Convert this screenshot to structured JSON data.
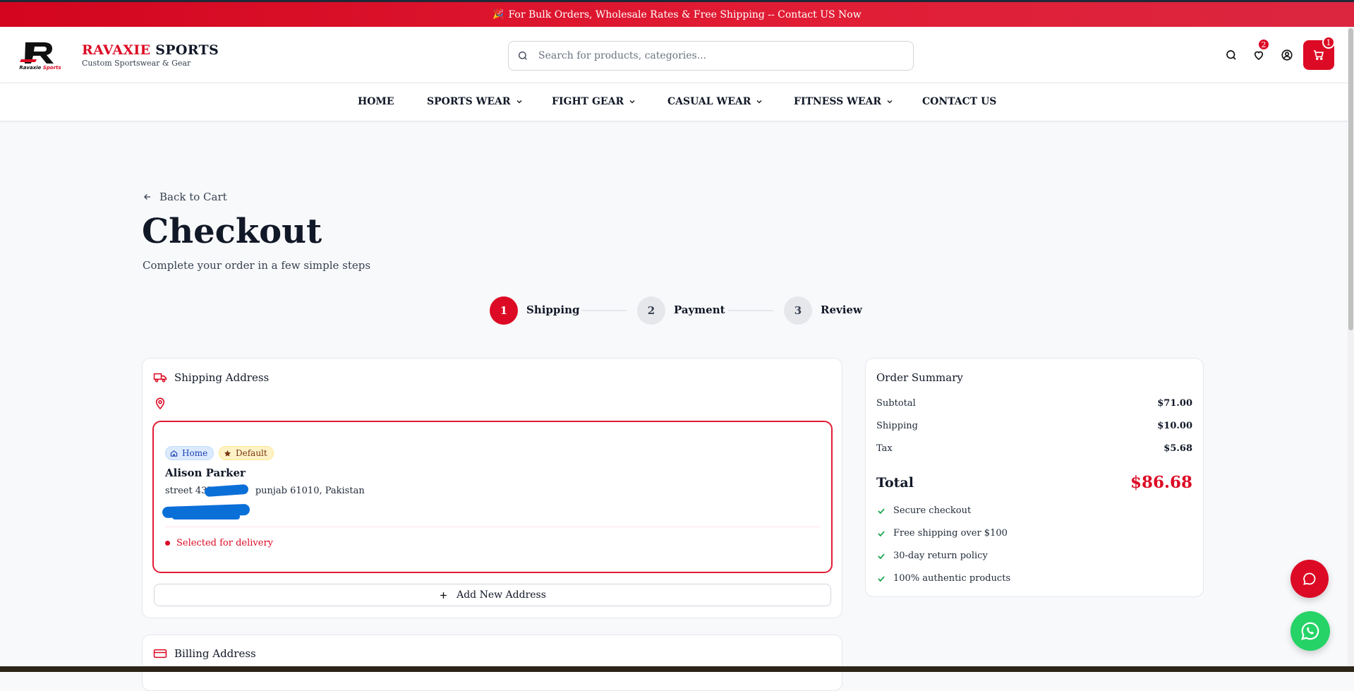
{
  "colors": {
    "accent": "#dc0a24",
    "whatsapp": "#25d366",
    "home_pill": "#dbeafe",
    "default_pill": "#fef3c7"
  },
  "promo": {
    "text": "For Bulk Orders, Wholesale Rates & Free Shipping -- Contact US Now",
    "icon": "party-popper-icon"
  },
  "brand": {
    "name_red": "RAVAXIE",
    "name_dark": " SPORTS",
    "tagline": "Custom Sportswear & Gear",
    "logo_text": "Ravaxie Sports"
  },
  "search": {
    "placeholder": "Search for products, categories..."
  },
  "header_icons": {
    "wishlist_count": "2",
    "cart_count": "1"
  },
  "nav": {
    "home": "HOME",
    "sports_wear": "SPORTS WEAR",
    "fight_gear": "FIGHT GEAR",
    "casual_wear": "CASUAL WEAR",
    "fitness_wear": "FITNESS WEAR",
    "contact_us": "CONTACT US"
  },
  "page": {
    "back_label": "Back to Cart",
    "title": "Checkout",
    "subtitle": "Complete your order in a few simple steps"
  },
  "steps": [
    {
      "number": "1",
      "label": "Shipping",
      "active": true
    },
    {
      "number": "2",
      "label": "Payment",
      "active": false
    },
    {
      "number": "3",
      "label": "Review",
      "active": false
    }
  ],
  "shipping": {
    "title": "Shipping Address",
    "address": {
      "tag_home": "Home",
      "tag_default": "Default",
      "name": "Alison Parker",
      "line_start": "street 437,",
      "line_end": "punjab 61010, Pakistan",
      "status": "Selected for delivery"
    },
    "add_new_label": "Add New Address"
  },
  "billing": {
    "title": "Billing Address"
  },
  "summary": {
    "title": "Order Summary",
    "subtotal_label": "Subtotal",
    "subtotal_value": "$71.00",
    "shipping_label": "Shipping",
    "shipping_value": "$10.00",
    "tax_label": "Tax",
    "tax_value": "$5.68",
    "total_label": "Total",
    "total_value": "$86.68",
    "features": [
      "Secure checkout",
      "Free shipping over $100",
      "30-day return policy",
      "100% authentic products"
    ]
  }
}
